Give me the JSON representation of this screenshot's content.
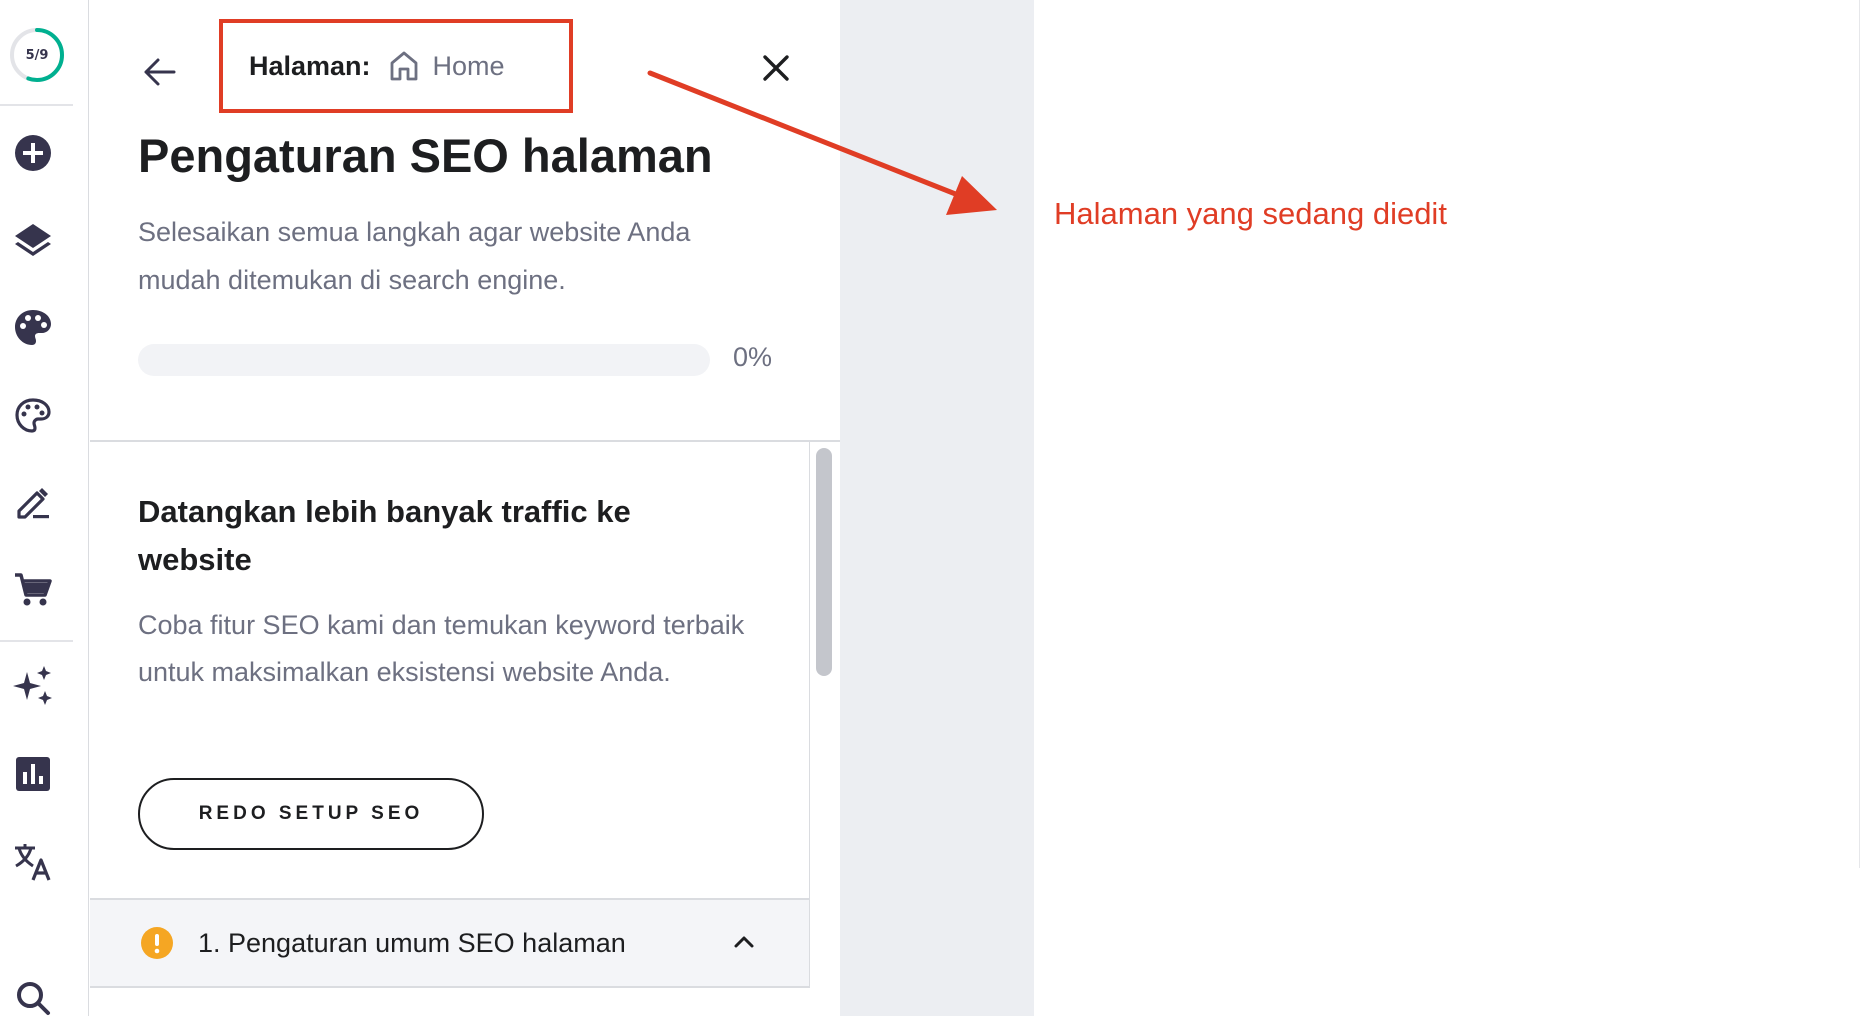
{
  "rail": {
    "progress_text": "5/9",
    "progress_fraction": 0.5556,
    "progress_color": "#00b090",
    "icons": [
      "add-icon",
      "layers-icon",
      "palette-filled-icon",
      "palette-outline-icon",
      "edit-icon",
      "cart-icon",
      "sparkles-icon",
      "analytics-icon",
      "translate-icon",
      "search-icon"
    ]
  },
  "panel": {
    "page_label": "Halaman:",
    "page_name": "Home",
    "title": "Pengaturan SEO halaman",
    "description": "Selesaikan semua langkah agar website Anda mudah ditemukan di search engine.",
    "progress_percent_text": "0%",
    "progress_value": 0,
    "card": {
      "title": "Datangkan lebih banyak traffic ke website",
      "description": "Coba fitur SEO kami dan temukan keyword terbaik untuk maksimalkan eksistensi website Anda.",
      "button_label": "REDO SETUP SEO"
    },
    "accordion": {
      "label": "1. Pengaturan umum SEO halaman",
      "status_color": "#f5a623"
    }
  },
  "annotation": {
    "text": "Halaman yang sedang diedit",
    "color": "#e03d25"
  }
}
